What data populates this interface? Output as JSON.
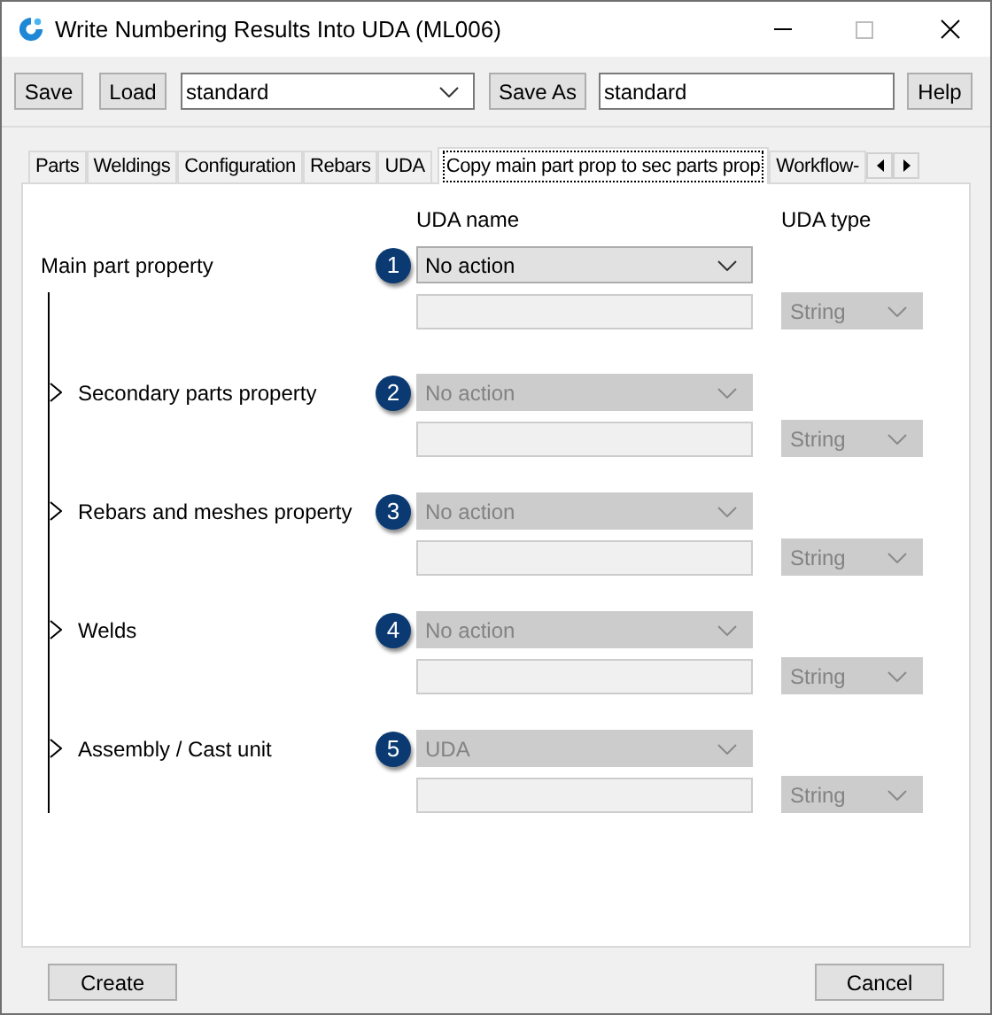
{
  "window": {
    "title": "Write Numbering Results Into UDA (ML006)"
  },
  "toolbar": {
    "save": "Save",
    "load": "Load",
    "preset": "standard",
    "save_as": "Save As",
    "save_as_name": "standard",
    "help": "Help"
  },
  "tabs": [
    {
      "label": "Parts",
      "selected": false
    },
    {
      "label": "Weldings",
      "selected": false
    },
    {
      "label": "Configuration",
      "selected": false
    },
    {
      "label": "Rebars",
      "selected": false
    },
    {
      "label": "UDA",
      "selected": false
    },
    {
      "label": "Copy main part prop to sec parts prop",
      "selected": true
    },
    {
      "label": "Workflow-",
      "selected": false
    }
  ],
  "columns": {
    "name": "UDA name",
    "type": "UDA type"
  },
  "sections": [
    {
      "kind": "main",
      "label": "Main part property",
      "badge": "1",
      "value": "No action",
      "disabled": false,
      "type": "String",
      "type_disabled": true
    },
    {
      "kind": "branch",
      "label": "Secondary parts property",
      "badge": "2",
      "value": "No action",
      "disabled": true,
      "type": "String",
      "type_disabled": true
    },
    {
      "kind": "branch",
      "label": "Rebars and meshes property",
      "badge": "3",
      "value": "No action",
      "disabled": true,
      "type": "String",
      "type_disabled": true
    },
    {
      "kind": "branch",
      "label": "Welds",
      "badge": "4",
      "value": "No action",
      "disabled": true,
      "type": "String",
      "type_disabled": true
    },
    {
      "kind": "branch",
      "label": "Assembly / Cast unit",
      "badge": "5",
      "value": "UDA",
      "disabled": true,
      "type": "String",
      "type_disabled": true
    }
  ],
  "footer": {
    "create": "Create",
    "cancel": "Cancel"
  }
}
